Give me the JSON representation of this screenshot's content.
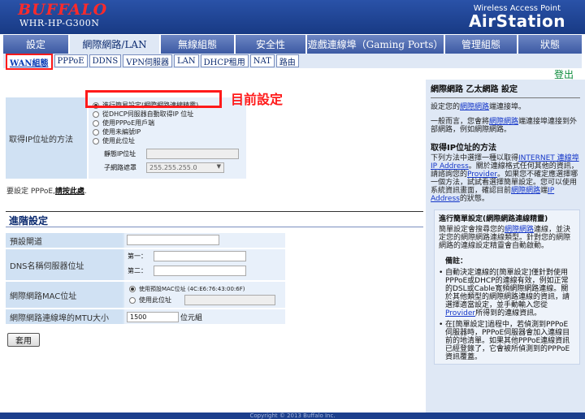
{
  "header": {
    "brand": "BUFFALO",
    "model": "WHR-HP-G300N",
    "product_line": "Wireless Access Point",
    "product_name": "AirStation"
  },
  "nav": {
    "tabs": [
      {
        "label": "設定"
      },
      {
        "label": "網際網路/LAN"
      },
      {
        "label": "無線組態"
      },
      {
        "label": "安全性"
      },
      {
        "label": "遊戲連線埠（Gaming Ports）"
      },
      {
        "label": "管理組態"
      },
      {
        "label": "狀態"
      }
    ],
    "active_index": 1
  },
  "subnav": {
    "tabs": [
      {
        "label": "WAN組態"
      },
      {
        "label": "PPPoE"
      },
      {
        "label": "DDNS"
      },
      {
        "label": "VPN伺服器"
      },
      {
        "label": "LAN"
      },
      {
        "label": "DHCP租用"
      },
      {
        "label": "NAT"
      },
      {
        "label": "路由"
      }
    ]
  },
  "logout": "登出",
  "wan": {
    "method_label": "取得IP位址的方法",
    "options": [
      {
        "label": "進行簡易設定(網際網路連線精靈)",
        "selected": true
      },
      {
        "label": "從DHCP伺服器自動取得IP 位址",
        "selected": false
      },
      {
        "label": "使用PPPoE用戶端",
        "selected": false
      },
      {
        "label": "使用未編號IP",
        "selected": false
      },
      {
        "label": "使用此位址",
        "selected": false
      }
    ],
    "static_ip_label": "靜態IP位址",
    "subnet_label": "子網路遮罩",
    "subnet_value": "255.255.255.0",
    "annotation": "目前設定",
    "pppoe_note_prefix": "要設定 PPPoE,",
    "pppoe_note_link": "請按此處",
    "pppoe_note_suffix": "."
  },
  "advanced": {
    "title": "進階設定",
    "gateway_label": "預設閘道",
    "dns_label": "DNS名稱伺服器位址",
    "dns_primary": "第一：",
    "dns_secondary": "第二：",
    "mac_label": "網際網路MAC位址",
    "mac_default": "使用預設MAC位址 (4C:E6:76:43:00:6F)",
    "mac_custom": "使用此位址",
    "mtu_label": "網際網路連線埠的MTU大小",
    "mtu_value": "1500",
    "mtu_unit": "位元組",
    "apply": "套用"
  },
  "help": {
    "title": "網際網路 乙太網路 設定",
    "p1_prefix": "設定您的",
    "p1_link": "網際網路",
    "p1_suffix": "端連接埠。",
    "p2_prefix": "一般而言，您會將",
    "p2_link": "網際網路",
    "p2_suffix": "端連接埠連接到外部網路，例如網際網路。",
    "h2": "取得IP位址的方法",
    "p3_prefix": "下列方法中選擇一種以取得",
    "p3_link1": "INTERNET 連線埠 IP Address",
    "p3_mid": "。關於連線格式任何其他的資訊，請諮詢您的",
    "p3_link2": "Provider",
    "p3_mid2": "。如果您不確定應選擇哪一個方法，試試看選擇簡單設定。您可以使用系統資訊畫面，確認目前",
    "p3_link3": "網際網路",
    "p3_mid3": "端",
    "p3_link4": "IP Address",
    "p3_suffix": "的狀態。",
    "box_title": "進行簡單設定(網際網路連線精靈)",
    "box_p_prefix": "簡單設定會搜尋您的",
    "box_p_link": "網際網路",
    "box_p_suffix": "連線，並決定您的網際網路連線類型。針對您的網際網路的連線設定精靈會自動啟動。",
    "remark_title": "備註：",
    "b1_prefix": "自動決定連線的[簡單設定]僅針對使用PPPoE或DHCP的連線有效，例如正常的DSL或Cable寬頻網際網路連線。關於其他類型的網際網路連線的資訊，請選擇適當設定，並手動輸入您從",
    "b1_link": "Provider",
    "b1_suffix": "所得到的連線資訊。",
    "b2": "在[簡單設定]過程中，若偵測到PPPoE伺服器時，PPPoE伺服器會加入連線目前的地清單。如果其他PPPoE連線資訊已經登錄了，它會被所偵測到的PPPoE 資訊覆蓋。"
  },
  "footer": "Copyright © 2013 Buffalo Inc."
}
